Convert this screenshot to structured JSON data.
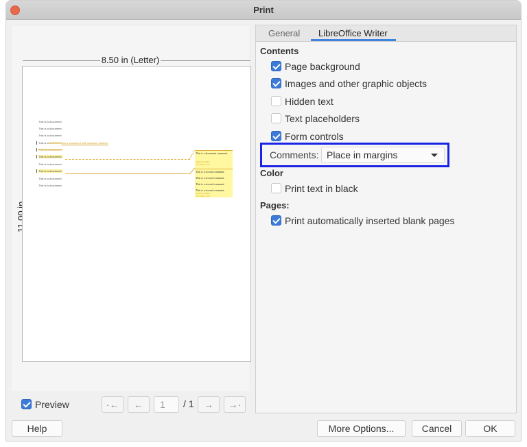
{
  "window": {
    "title": "Print"
  },
  "preview": {
    "width_label": "8.50 in (Letter)",
    "height_label": "11.00 in",
    "document_lines": [
      "This is a document.",
      "This is a document.",
      "This is a document.",
      "This is a document with tracked changes.",
      "This is a document.",
      "This is a document.",
      "This is a document.",
      "This is a document.",
      "This is a document.",
      "This is a document."
    ],
    "tracked_insert": "this a document with windows tracked.",
    "tracked_prefix": "This is a ",
    "tracked_deleted": "document",
    "comments": [
      {
        "text": "This is a document comment.",
        "author": "Unknown Author",
        "date": "10/17/2023 12:11"
      },
      {
        "lines": [
          "This is a second comment.",
          "This is a second comment.",
          "This is a second comment.",
          "This is a second comment."
        ],
        "author": "Unknown Author",
        "date": "10/17/2023 12:13"
      }
    ],
    "preview_checkbox": {
      "label": "Preview",
      "checked": true
    },
    "page_input": "1",
    "page_total": "/ 1",
    "nav": {
      "first": "·←",
      "prev": "←",
      "next": "→",
      "last": "→·"
    }
  },
  "tabs": [
    {
      "label": "General",
      "active": false
    },
    {
      "label": "LibreOffice Writer",
      "active": true
    }
  ],
  "sections": {
    "contents": {
      "heading": "Contents",
      "options": [
        {
          "label": "Page background",
          "checked": true
        },
        {
          "label": "Images and other graphic objects",
          "checked": true
        },
        {
          "label": "Hidden text",
          "checked": false
        },
        {
          "label": "Text placeholders",
          "checked": false
        },
        {
          "label": "Form controls",
          "checked": true
        }
      ],
      "comments_label": "Comments:",
      "comments_value": "Place in margins"
    },
    "color": {
      "heading": "Color",
      "options": [
        {
          "label": "Print text in black",
          "checked": false
        }
      ]
    },
    "pages": {
      "heading": "Pages:",
      "options": [
        {
          "label": "Print automatically inserted blank pages",
          "checked": true
        }
      ]
    }
  },
  "buttons": {
    "help": "Help",
    "more_options": "More Options...",
    "cancel": "Cancel",
    "ok": "OK"
  },
  "colors": {
    "accent": "#3d7bd9",
    "highlight_border": "#1a22e6",
    "comment_bg": "#fff8a0",
    "tracked_change": "#d4a020"
  }
}
